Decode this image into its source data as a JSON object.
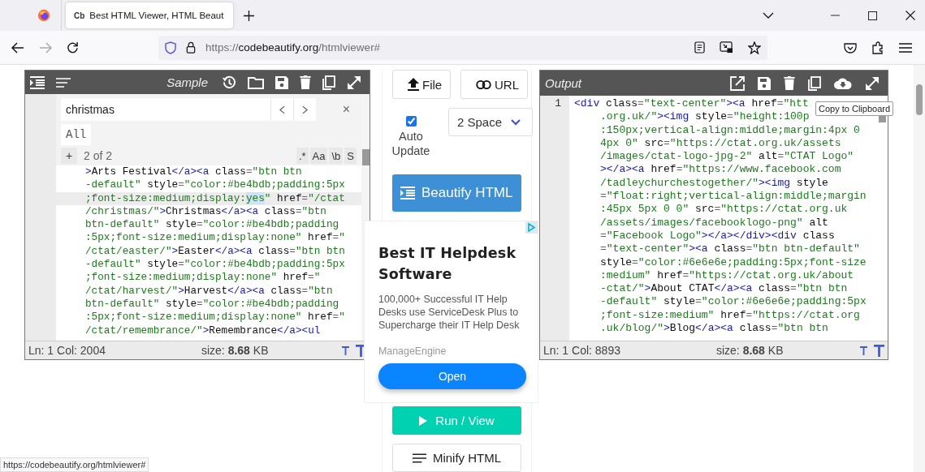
{
  "browser": {
    "tabs": [
      {
        "favicon": "Cb",
        "title": "Best HTML Viewer, HTML Beaut",
        "selected": true
      }
    ],
    "url": {
      "scheme": "https://",
      "host": "codebeautify.org",
      "path": "/htmlviewer#"
    }
  },
  "input_editor": {
    "title": "Sample",
    "search": {
      "value": "christmas",
      "scope": "All",
      "add": "+",
      "count": "2 of 2",
      "close": "×",
      "options": [
        ".*",
        "Aa",
        "\\b",
        "S"
      ]
    },
    "lines": [
      {
        "highlighted": false,
        "tokens": [
          {
            "kind": "tag",
            "text": ">"
          },
          {
            "kind": "text",
            "text": "Arts Festival"
          },
          {
            "kind": "tag",
            "text": "</a><a"
          },
          {
            "kind": "attr",
            "text": " class"
          },
          {
            "kind": "op",
            "text": "="
          },
          {
            "kind": "str",
            "text": "\"btn btn"
          }
        ]
      },
      {
        "highlighted": false,
        "tokens": [
          {
            "kind": "str",
            "text": "-default\""
          },
          {
            "kind": "attr",
            "text": " style"
          },
          {
            "kind": "op",
            "text": "="
          },
          {
            "kind": "str",
            "text": "\"color:#be4bdb;padding:5px"
          }
        ]
      },
      {
        "highlighted": true,
        "tokens": [
          {
            "kind": "str",
            "text": ";font-size:medium;display:"
          },
          {
            "kind": "match",
            "text": "yes"
          },
          {
            "kind": "str",
            "text": "\""
          },
          {
            "kind": "attr",
            "text": " href"
          },
          {
            "kind": "op",
            "text": "="
          },
          {
            "kind": "str",
            "text": "\"/ctat"
          }
        ]
      },
      {
        "highlighted": false,
        "tokens": [
          {
            "kind": "str",
            "text": "/christmas/\""
          },
          {
            "kind": "tag",
            "text": ">"
          },
          {
            "kind": "text",
            "text": "Christmas"
          },
          {
            "kind": "tag",
            "text": "</a><a"
          },
          {
            "kind": "attr",
            "text": " class"
          },
          {
            "kind": "op",
            "text": "="
          },
          {
            "kind": "str",
            "text": "\"btn"
          }
        ]
      },
      {
        "highlighted": false,
        "tokens": [
          {
            "kind": "str",
            "text": "btn-default\""
          },
          {
            "kind": "attr",
            "text": " style"
          },
          {
            "kind": "op",
            "text": "="
          },
          {
            "kind": "str",
            "text": "\"color:#be4bdb;padding"
          }
        ]
      },
      {
        "highlighted": false,
        "tokens": [
          {
            "kind": "str",
            "text": ":5px;font-size:medium;display:none\""
          },
          {
            "kind": "attr",
            "text": " href"
          },
          {
            "kind": "op",
            "text": "="
          },
          {
            "kind": "str",
            "text": "\""
          }
        ]
      },
      {
        "highlighted": false,
        "tokens": [
          {
            "kind": "str",
            "text": "/ctat/easter/\""
          },
          {
            "kind": "tag",
            "text": ">"
          },
          {
            "kind": "text",
            "text": "Easter"
          },
          {
            "kind": "tag",
            "text": "</a><a"
          },
          {
            "kind": "attr",
            "text": " class"
          },
          {
            "kind": "op",
            "text": "="
          },
          {
            "kind": "str",
            "text": "\"btn btn"
          }
        ]
      },
      {
        "highlighted": false,
        "tokens": [
          {
            "kind": "str",
            "text": "-default\""
          },
          {
            "kind": "attr",
            "text": " style"
          },
          {
            "kind": "op",
            "text": "="
          },
          {
            "kind": "str",
            "text": "\"color:#be4bdb;padding:5px"
          }
        ]
      },
      {
        "highlighted": false,
        "tokens": [
          {
            "kind": "str",
            "text": ";font-size:medium;display:none\""
          },
          {
            "kind": "attr",
            "text": " href"
          },
          {
            "kind": "op",
            "text": "="
          },
          {
            "kind": "str",
            "text": "\""
          }
        ]
      },
      {
        "highlighted": false,
        "tokens": [
          {
            "kind": "str",
            "text": "/ctat/harvest/\""
          },
          {
            "kind": "tag",
            "text": ">"
          },
          {
            "kind": "text",
            "text": "Harvest"
          },
          {
            "kind": "tag",
            "text": "</a><a"
          },
          {
            "kind": "attr",
            "text": " class"
          },
          {
            "kind": "op",
            "text": "="
          },
          {
            "kind": "str",
            "text": "\"btn"
          }
        ]
      },
      {
        "highlighted": false,
        "tokens": [
          {
            "kind": "str",
            "text": "btn-default\""
          },
          {
            "kind": "attr",
            "text": " style"
          },
          {
            "kind": "op",
            "text": "="
          },
          {
            "kind": "str",
            "text": "\"color:#be4bdb;padding"
          }
        ]
      },
      {
        "highlighted": false,
        "tokens": [
          {
            "kind": "str",
            "text": ":5px;font-size:medium;display:none\""
          },
          {
            "kind": "attr",
            "text": " href"
          },
          {
            "kind": "op",
            "text": "="
          },
          {
            "kind": "str",
            "text": "\""
          }
        ]
      },
      {
        "highlighted": false,
        "tokens": [
          {
            "kind": "str",
            "text": "/ctat/remembrance/\""
          },
          {
            "kind": "tag",
            "text": ">"
          },
          {
            "kind": "text",
            "text": "Remembrance"
          },
          {
            "kind": "tag",
            "text": "</a><ul"
          }
        ]
      }
    ],
    "status": {
      "position": "Ln: 1 Col: 2004",
      "size": "size: **8.68** KB"
    }
  },
  "middle": {
    "file": "File",
    "url": "URL",
    "auto_update": {
      "label": "Auto Update",
      "checked": true
    },
    "indent": "2 Space",
    "beautify": "Beautify HTML",
    "run": "Run / View",
    "minify": "Minify HTML"
  },
  "ad": {
    "title": "Best IT Helpdesk Software",
    "body": "100,000+ Successful IT Help Desks use ServiceDesk Plus to Supercharge their IT Help Desk",
    "advertiser": "ManageEngine",
    "button": "Open"
  },
  "output_editor": {
    "title": "Output",
    "tooltip": "Copy to Clipboard",
    "lines": [
      {
        "number": "1",
        "tokens": [
          {
            "kind": "tag",
            "text": "<div"
          },
          {
            "kind": "attr",
            "text": " class"
          },
          {
            "kind": "op",
            "text": "="
          },
          {
            "kind": "str",
            "text": "\"text-center\""
          },
          {
            "kind": "tag",
            "text": "><a"
          },
          {
            "kind": "attr",
            "text": " href"
          },
          {
            "kind": "op",
            "text": "="
          },
          {
            "kind": "str",
            "text": "\"htt"
          }
        ]
      },
      {
        "tokens": [
          {
            "kind": "str",
            "text": ".org.uk/\""
          },
          {
            "kind": "tag",
            "text": "><img"
          },
          {
            "kind": "attr",
            "text": " style"
          },
          {
            "kind": "op",
            "text": "="
          },
          {
            "kind": "str",
            "text": "\"height:100p"
          }
        ]
      },
      {
        "tokens": [
          {
            "kind": "str",
            "text": ":150px;vertical-align:middle;margin:4px 0"
          }
        ]
      },
      {
        "tokens": [
          {
            "kind": "str",
            "text": "4px 0\""
          },
          {
            "kind": "attr",
            "text": " src"
          },
          {
            "kind": "op",
            "text": "="
          },
          {
            "kind": "str",
            "text": "\"https://ctat.org.uk/assets"
          }
        ]
      },
      {
        "tokens": [
          {
            "kind": "str",
            "text": "/images/ctat-logo-jpg-2\""
          },
          {
            "kind": "attr",
            "text": " alt"
          },
          {
            "kind": "op",
            "text": "="
          },
          {
            "kind": "str",
            "text": "\"CTAT Logo\""
          }
        ]
      },
      {
        "tokens": [
          {
            "kind": "tag",
            "text": "></a><a"
          },
          {
            "kind": "attr",
            "text": " href"
          },
          {
            "kind": "op",
            "text": "="
          },
          {
            "kind": "str",
            "text": "\"https://www.facebook.com"
          }
        ]
      },
      {
        "tokens": [
          {
            "kind": "str",
            "text": "/tadleychurchestogether/\""
          },
          {
            "kind": "tag",
            "text": "><img"
          },
          {
            "kind": "attr",
            "text": " style"
          }
        ]
      },
      {
        "tokens": [
          {
            "kind": "op",
            "text": "="
          },
          {
            "kind": "str",
            "text": "\"float:right;vertical-align:middle;margin"
          }
        ]
      },
      {
        "tokens": [
          {
            "kind": "str",
            "text": ":45px 5px 0 0\""
          },
          {
            "kind": "attr",
            "text": " src"
          },
          {
            "kind": "op",
            "text": "="
          },
          {
            "kind": "str",
            "text": "\"https://ctat.org.uk"
          }
        ]
      },
      {
        "tokens": [
          {
            "kind": "str",
            "text": "/assets/images/facebooklogo-png\""
          },
          {
            "kind": "attr",
            "text": " alt"
          }
        ]
      },
      {
        "tokens": [
          {
            "kind": "op",
            "text": "="
          },
          {
            "kind": "str",
            "text": "\"Facebook Logo\""
          },
          {
            "kind": "tag",
            "text": "></a></div><div"
          },
          {
            "kind": "attr",
            "text": " class"
          }
        ]
      },
      {
        "tokens": [
          {
            "kind": "op",
            "text": "="
          },
          {
            "kind": "str",
            "text": "\"text-center\""
          },
          {
            "kind": "tag",
            "text": "><a"
          },
          {
            "kind": "attr",
            "text": " class"
          },
          {
            "kind": "op",
            "text": "="
          },
          {
            "kind": "str",
            "text": "\"btn btn-default\""
          }
        ]
      },
      {
        "tokens": [
          {
            "kind": "attr",
            "text": "style"
          },
          {
            "kind": "op",
            "text": "="
          },
          {
            "kind": "str",
            "text": "\"color:#6e6e6e;padding:5px;font-size"
          }
        ]
      },
      {
        "tokens": [
          {
            "kind": "str",
            "text": ":medium\""
          },
          {
            "kind": "attr",
            "text": " href"
          },
          {
            "kind": "op",
            "text": "="
          },
          {
            "kind": "str",
            "text": "\"https://ctat.org.uk/about"
          }
        ]
      },
      {
        "tokens": [
          {
            "kind": "str",
            "text": "-ctat/\""
          },
          {
            "kind": "tag",
            "text": ">"
          },
          {
            "kind": "text",
            "text": "About CTAT"
          },
          {
            "kind": "tag",
            "text": "</a><a"
          },
          {
            "kind": "attr",
            "text": " class"
          },
          {
            "kind": "op",
            "text": "="
          },
          {
            "kind": "str",
            "text": "\"btn btn"
          }
        ]
      },
      {
        "tokens": [
          {
            "kind": "str",
            "text": "-default\""
          },
          {
            "kind": "attr",
            "text": " style"
          },
          {
            "kind": "op",
            "text": "="
          },
          {
            "kind": "str",
            "text": "\"color:#6e6e6e;padding:5px"
          }
        ]
      },
      {
        "tokens": [
          {
            "kind": "str",
            "text": ";font-size:medium\""
          },
          {
            "kind": "attr",
            "text": " href"
          },
          {
            "kind": "op",
            "text": "="
          },
          {
            "kind": "str",
            "text": "\"https://ctat.org"
          }
        ]
      },
      {
        "tokens": [
          {
            "kind": "str",
            "text": ".uk/blog/\""
          },
          {
            "kind": "tag",
            "text": ">"
          },
          {
            "kind": "text",
            "text": "Blog"
          },
          {
            "kind": "tag",
            "text": "</a><a"
          },
          {
            "kind": "attr",
            "text": " class"
          },
          {
            "kind": "op",
            "text": "="
          },
          {
            "kind": "str",
            "text": "\"btn btn"
          }
        ]
      }
    ],
    "status": {
      "position": "Ln: 1 Col: 8893",
      "size": "size: **8.68** KB"
    }
  },
  "status_link": "https://codebeautify.org/htmlviewer#"
}
